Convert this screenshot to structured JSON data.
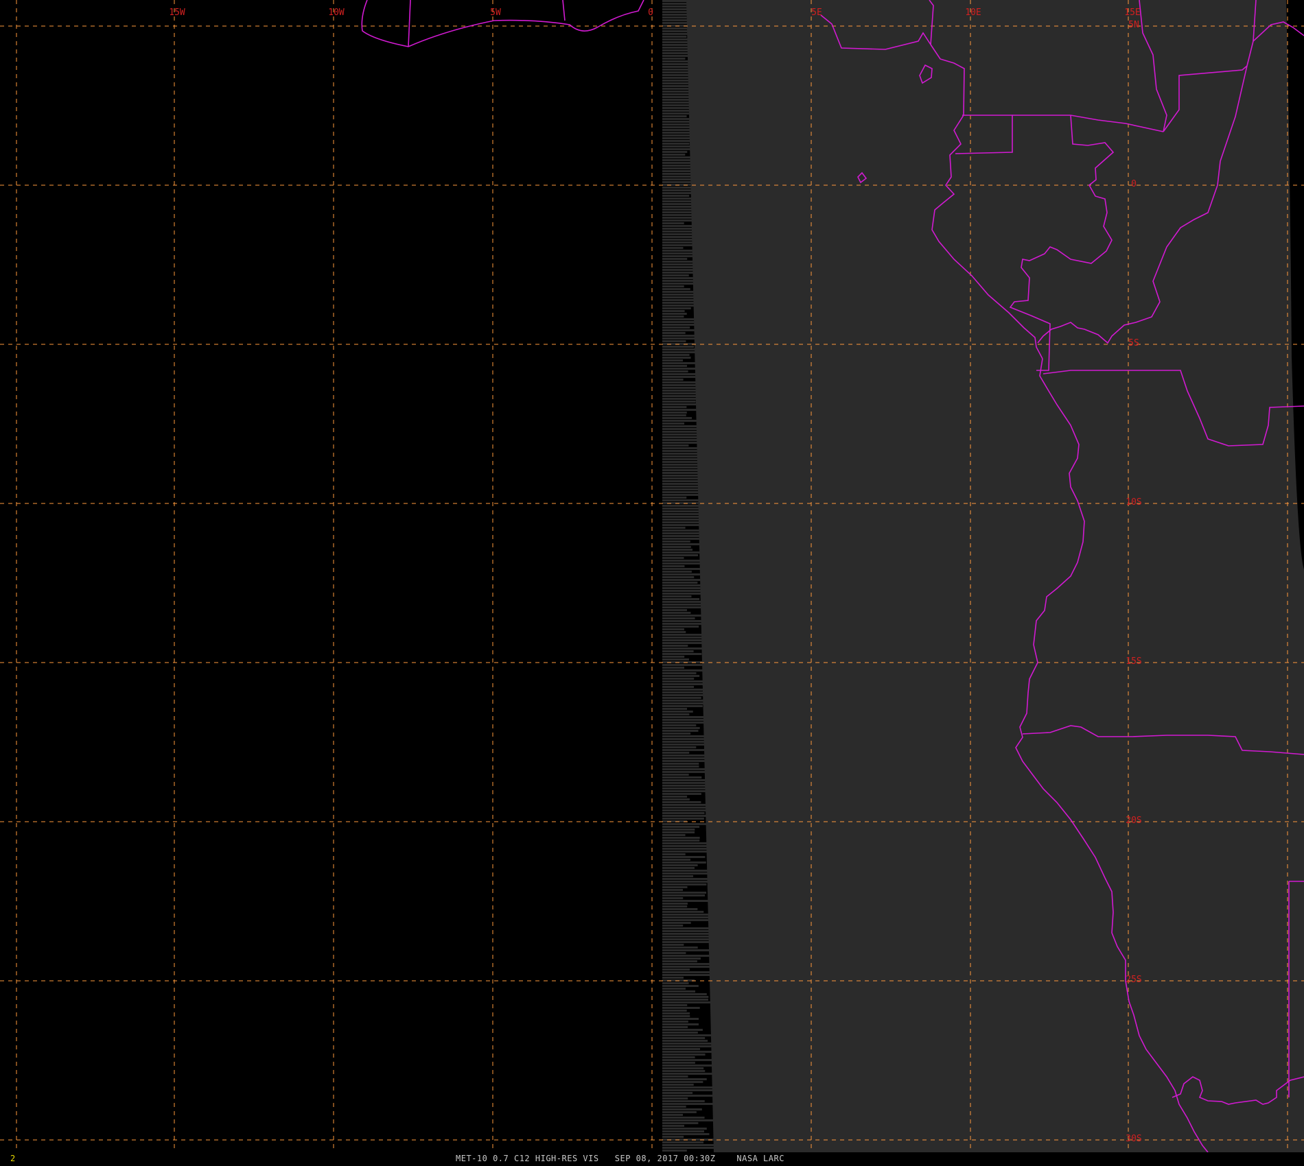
{
  "map": {
    "colors": {
      "space": "#000000",
      "earth": "#2b2b2b",
      "graticule": "#ff9a3c",
      "borders": "#d21ad2",
      "labels": "#d22020",
      "frame_number": "#e8d800",
      "caption": "#c8c8c8"
    },
    "longitude_labels": [
      "15W",
      "10W",
      "5W",
      "0",
      "5E",
      "10E",
      "15E"
    ],
    "latitude_labels": [
      "5N",
      "0",
      "5S",
      "10S",
      "15S",
      "20S",
      "25S",
      "30S"
    ]
  },
  "footer": {
    "frame_number": "2",
    "caption": "MET-10 0.7 C12 HIGH-RES VIS   SEP 08, 2017 00:30Z    NASA LARC"
  }
}
